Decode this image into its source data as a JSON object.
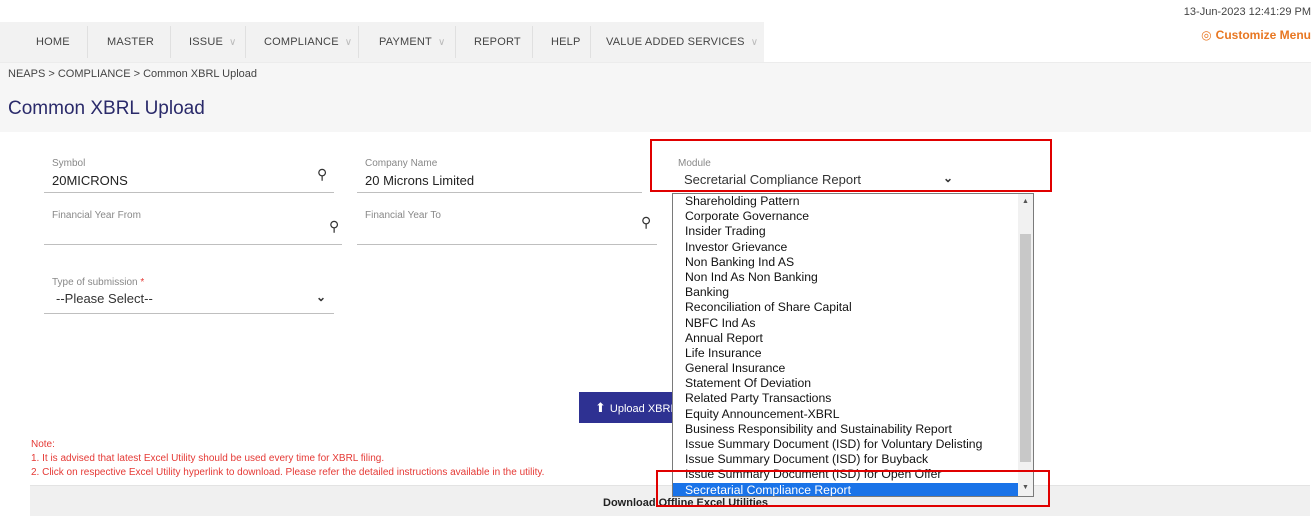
{
  "nav": {
    "items": [
      "HOME",
      "MASTER",
      "ISSUE",
      "COMPLIANCE",
      "PAYMENT",
      "REPORT",
      "HELP",
      "VALUE ADDED SERVICES"
    ]
  },
  "header": {
    "datetime": "13-Jun-2023 12:41:29 PM",
    "customize_label": "Customize Menu"
  },
  "breadcrumb": "NEAPS > COMPLIANCE > Common XBRL Upload",
  "page_title": "Common XBRL Upload",
  "form": {
    "symbol_label": "Symbol",
    "symbol_value": "20MICRONS",
    "company_label": "Company Name",
    "company_value": "20 Microns Limited",
    "module_label": "Module",
    "module_value": "Secretarial Compliance Report",
    "fy_from_label": "Financial Year From",
    "fy_to_label": "Financial Year To",
    "submission_label": "Type of submission",
    "submission_required": "*",
    "submission_value": "--Please Select--"
  },
  "upload_label": "Upload XBRL",
  "notes": [
    "Note:",
    "1. It is advised that latest Excel Utility should be used every time for XBRL filing.",
    "2. Click on respective Excel Utility hyperlink to download. Please refer the detailed instructions available in the utility."
  ],
  "download_label": "Download Offline Excel Utilities",
  "module_options": [
    "Shareholding Pattern",
    "Corporate Governance",
    "Insider Trading",
    "Investor Grievance",
    "Non Banking Ind AS",
    "Non Ind As Non Banking",
    "Banking",
    "Reconciliation of Share Capital",
    "NBFC Ind As",
    "Annual Report",
    "Life Insurance",
    "General Insurance",
    "Statement Of Deviation",
    "Related Party Transactions",
    "Equity Announcement-XBRL",
    "Business Responsibility and Sustainability Report",
    "Issue Summary Document (ISD) for Voluntary Delisting",
    "Issue Summary Document (ISD) for Buyback",
    "Issue Summary Document (ISD) for Open Offer",
    "Secretarial Compliance Report"
  ],
  "module_selected_index": 19,
  "colors": {
    "accent": "#e87722",
    "button": "#2e3192",
    "highlight": "#e00000",
    "selection": "#1a73e8"
  }
}
